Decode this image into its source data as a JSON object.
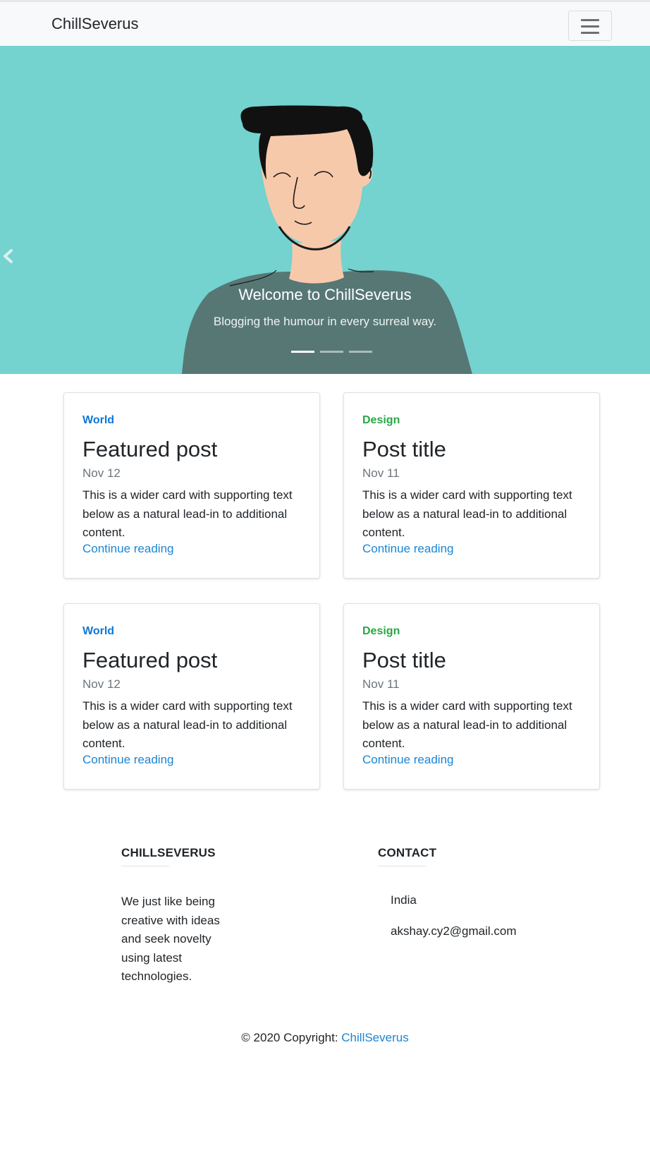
{
  "navbar": {
    "brand": "ChillSeverus",
    "toggler_icon": "hamburger-menu-icon"
  },
  "hero": {
    "title": "Welcome to ChillSeverus",
    "subtitle": "Blogging the humour in every surreal way.",
    "background_color": "#74d2cf",
    "prev_icon": "chevron-left-icon",
    "indicator_count": 3,
    "active_indicator": 1
  },
  "cards": [
    {
      "category": "World",
      "title": "Featured post",
      "date": "Nov 12",
      "text": "This is a wider card with supporting text below as a natural lead-in to additional content.",
      "link": "Continue reading"
    },
    {
      "category": "Design",
      "title": "Post title",
      "date": "Nov 11",
      "text": "This is a wider card with supporting text below as a natural lead-in to additional content.",
      "link": "Continue reading"
    },
    {
      "category": "World",
      "title": "Featured post",
      "date": "Nov 12",
      "text": "This is a wider card with supporting text below as a natural lead-in to additional content.",
      "link": "Continue reading"
    },
    {
      "category": "Design",
      "title": "Post title",
      "date": "Nov 11",
      "text": "This is a wider card with supporting text below as a natural lead-in to additional content.",
      "link": "Continue reading"
    }
  ],
  "colors": {
    "world": "#0d78d6",
    "design": "#28a745",
    "link": "#1b85d4"
  },
  "footer": {
    "about_heading": "CHILLSEVERUS",
    "about_text": "We just like being creative with ideas and seek novelty using latest technologies.",
    "contact_heading": "CONTACT",
    "contact_country": "India",
    "contact_email": "akshay.cy2@gmail.com",
    "copyright_prefix": "© 2020 Copyright: ",
    "copyright_link": "ChillSeverus"
  }
}
